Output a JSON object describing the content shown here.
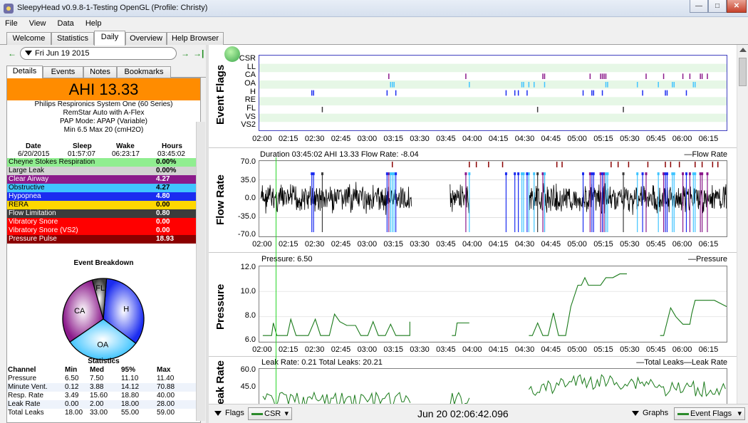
{
  "window": {
    "title": "SleepyHead v0.9.8-1-Testing OpenGL (Profile: Christy)"
  },
  "menu": [
    "File",
    "View",
    "Data",
    "Help"
  ],
  "tabs": [
    "Welcome",
    "Statistics",
    "Daily",
    "Overview",
    "Help Browser"
  ],
  "active_tab": "Daily",
  "datebar": {
    "date": "Fri Jun 19 2015"
  },
  "left_tabs": [
    "Details",
    "Events",
    "Notes",
    "Bookmarks"
  ],
  "ahi": "AHI 13.33",
  "device": [
    "Philips Respironics System One (60 Series)",
    "RemStar Auto with A-Flex",
    "PAP Mode: APAP (Variable)",
    "Min 6.5 Max 20 (cmH2O)"
  ],
  "summary": {
    "headers": [
      "Date",
      "Sleep",
      "Wake",
      "Hours"
    ],
    "values": [
      "6/20/2015",
      "01:57:07",
      "06:23:17",
      "03:45:02"
    ]
  },
  "indices": [
    {
      "label": "Cheyne Stokes Respiration",
      "value": "0.00%",
      "color": "#90ee90",
      "fg": "#000000"
    },
    {
      "label": "Large Leak",
      "value": "0.00%",
      "color": "#d3d3d3",
      "fg": "#000000"
    },
    {
      "label": "Clear Airway",
      "value": "4.27",
      "color": "#8b1a8b",
      "fg": "#ffffff"
    },
    {
      "label": "Obstructive",
      "value": "4.27",
      "color": "#40c4ff",
      "fg": "#000000"
    },
    {
      "label": "Hypopnea",
      "value": "4.80",
      "color": "#1b2cf0",
      "fg": "#ffffff"
    },
    {
      "label": "RERA",
      "value": "0.00",
      "color": "#ffd700",
      "fg": "#000000"
    },
    {
      "label": "Flow Limitation",
      "value": "0.80",
      "color": "#3c3c3c",
      "fg": "#ffffff"
    },
    {
      "label": "Vibratory Snore",
      "value": "0.00",
      "color": "#ff0000",
      "fg": "#ffffff"
    },
    {
      "label": "Vibratory Snore (VS2)",
      "value": "0.00",
      "color": "#ff0000",
      "fg": "#ffffff"
    },
    {
      "label": "Pressure Pulse",
      "value": "18.93",
      "color": "#8b0000",
      "fg": "#ffffff"
    }
  ],
  "event_breakdown": {
    "title": "Event Breakdown",
    "slices": [
      {
        "name": "H",
        "value": 4.8,
        "color": "#1b2cf0"
      },
      {
        "name": "OA",
        "value": 4.27,
        "color": "#40c4ff"
      },
      {
        "name": "CA",
        "value": 4.27,
        "color": "#8b1a8b"
      },
      {
        "name": "FL",
        "value": 0.8,
        "color": "#3c3c3c"
      }
    ]
  },
  "statistics": {
    "title": "Statistics",
    "headers": [
      "Channel",
      "Min",
      "Med",
      "95%",
      "Max"
    ],
    "rows": [
      [
        "Pressure",
        "6.50",
        "7.50",
        "11.10",
        "11.40"
      ],
      [
        "Minute Vent.",
        "0.12",
        "3.88",
        "14.12",
        "70.88"
      ],
      [
        "Resp. Rate",
        "3.49",
        "15.60",
        "18.80",
        "40.00"
      ],
      [
        "Leak Rate",
        "0.00",
        "2.00",
        "18.00",
        "28.00"
      ],
      [
        "Total Leaks",
        "18.00",
        "33.00",
        "55.00",
        "59.00"
      ]
    ]
  },
  "time_ticks": [
    "02:00",
    "02:15",
    "02:30",
    "02:45",
    "03:00",
    "03:15",
    "03:30",
    "03:45",
    "04:00",
    "04:15",
    "04:30",
    "04:45",
    "05:00",
    "05:15",
    "05:30",
    "05:45",
    "06:00",
    "06:15"
  ],
  "event_flags": {
    "title": "Event Flags",
    "rows": [
      "CSR",
      "LL",
      "CA",
      "OA",
      "H",
      "RE",
      "FL",
      "VS",
      "VS2"
    ],
    "colors": {
      "CA": "#8b1a8b",
      "OA": "#40c4ff",
      "H": "#1b2cf0",
      "FL": "#3c3c3c"
    },
    "events": {
      "CA": [
        "03:12",
        "03:56",
        "04:40",
        "04:41",
        "05:07",
        "05:13",
        "05:14",
        "05:15",
        "05:16",
        "05:39",
        "05:49",
        "06:00",
        "06:04",
        "06:10",
        "06:11",
        "06:14"
      ],
      "OA": [
        "03:13",
        "03:14",
        "03:15",
        "03:58",
        "04:28",
        "04:29",
        "04:32",
        "04:35",
        "04:41",
        "05:16",
        "05:17",
        "05:34",
        "05:46",
        "05:54",
        "05:55",
        "06:06",
        "06:07"
      ],
      "H": [
        "02:28",
        "02:29",
        "03:11",
        "03:16",
        "04:19",
        "04:24",
        "04:26",
        "04:31",
        "05:03",
        "05:08",
        "05:09",
        "05:14",
        "05:37",
        "05:50",
        "05:51",
        "06:02"
      ],
      "FL": [
        "02:34",
        "04:37",
        "05:26"
      ]
    }
  },
  "flow_rate": {
    "title": "Flow Rate",
    "header": "Duration 03:45:02 AHI 13.33 Flow Rate: -8.04",
    "legend": "Flow Rate",
    "yticks": [
      "70.0",
      "35.0",
      "0.0",
      "-35.0",
      "-70.0"
    ]
  },
  "pressure": {
    "title": "Pressure",
    "header": "Pressure: 6.50",
    "legend": "Pressure",
    "yticks": [
      "12.0",
      "10.0",
      "8.0",
      "6.0"
    ]
  },
  "leak_rate": {
    "title": "Leak Rate",
    "header": "Leak Rate: 0.21 Total Leaks: 20.21",
    "legend": "Total Leaks",
    "legend2": "Leak Rate",
    "yticks": [
      "60.0",
      "45.0"
    ]
  },
  "bottom": {
    "flags_label": "Flags",
    "flags_combo": "CSR",
    "datetime": "Jun 20 02:06:42.096",
    "graphs_label": "Graphs",
    "graphs_combo": "Event Flags"
  }
}
